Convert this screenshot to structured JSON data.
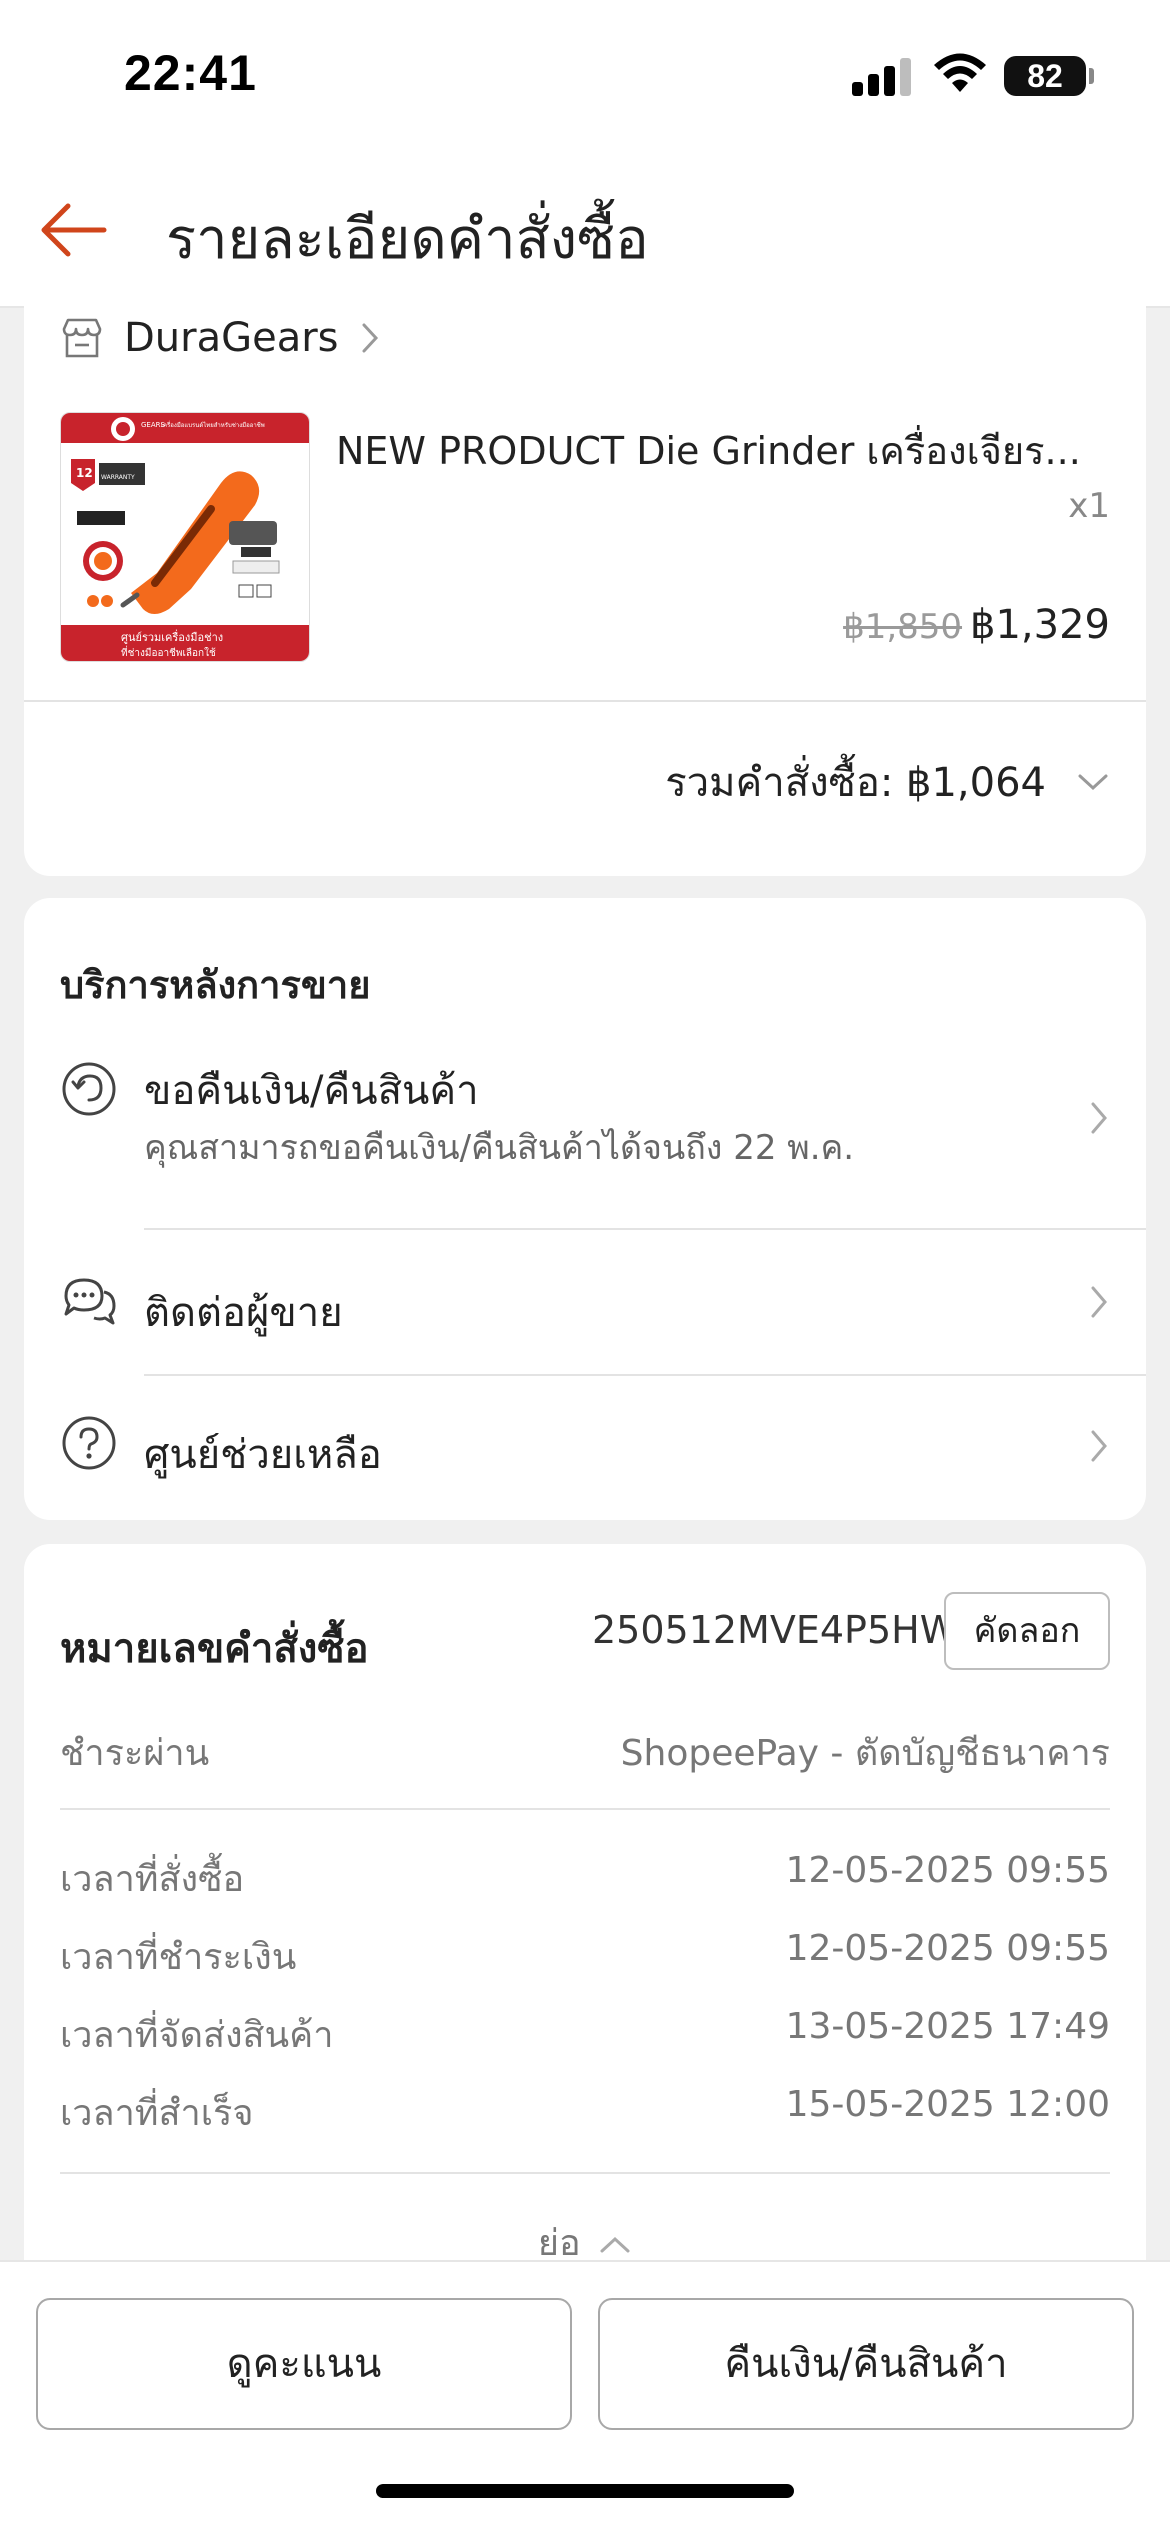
{
  "status_bar": {
    "time": "22:41",
    "battery": "82"
  },
  "header": {
    "title": "รายละเอียดคำสั่งซื้อ"
  },
  "shop": {
    "name": "DuraGears"
  },
  "product": {
    "name": "NEW PRODUCT Die Grinder เครื่องเจียร...",
    "quantity": "x1",
    "original_price": "฿1,850",
    "price": "฿1,329",
    "image_texts": {
      "top_banner": "เครื่องมือแบรนด์ไทยสำหรับช่างมืออาชีพ",
      "brand": "GEARS",
      "warranty": "12",
      "warranty_label": "WARRANTY",
      "bottom_line1": "ศูนย์รวมเครื่องมือช่าง",
      "bottom_line2": "ที่ช่างมืออาชีพเลือกใช้"
    }
  },
  "order_total": {
    "label": "รวมคำสั่งซื้อ: ฿1,064"
  },
  "after_sales": {
    "title": "บริการหลังการขาย",
    "items": [
      {
        "label": "ขอคืนเงิน/คืนสินค้า",
        "subtitle": "คุณสามารถขอคืนเงิน/คืนสินค้าได้จนถึง 22 พ.ค.",
        "icon": "return-icon"
      },
      {
        "label": "ติดต่อผู้ขาย",
        "icon": "chat-icon"
      },
      {
        "label": "ศูนย์ช่วยเหลือ",
        "icon": "help-icon"
      }
    ]
  },
  "order_info": {
    "order_number_label": "หมายเลขคำสั่งซื้อ",
    "order_number": "250512MVE4P5HW",
    "copy_label": "คัดลอก",
    "payment_label": "ชำระผ่าน",
    "payment_value": "ShopeePay - ตัดบัญชีธนาคาร",
    "times": [
      {
        "label": "เวลาที่สั่งซื้อ",
        "value": "12-05-2025 09:55"
      },
      {
        "label": "เวลาที่ชำระเงิน",
        "value": "12-05-2025 09:55"
      },
      {
        "label": "เวลาที่จัดส่งสินค้า",
        "value": "13-05-2025 17:49"
      },
      {
        "label": "เวลาที่สำเร็จ",
        "value": "15-05-2025 12:00"
      }
    ],
    "collapse_label": "ย่อ"
  },
  "bottom_actions": {
    "rate_label": "ดูคะแนน",
    "return_label": "คืนเงิน/คืนสินค้า"
  },
  "colors": {
    "accent": "#d0451b",
    "product_orange": "#f36a1c"
  }
}
